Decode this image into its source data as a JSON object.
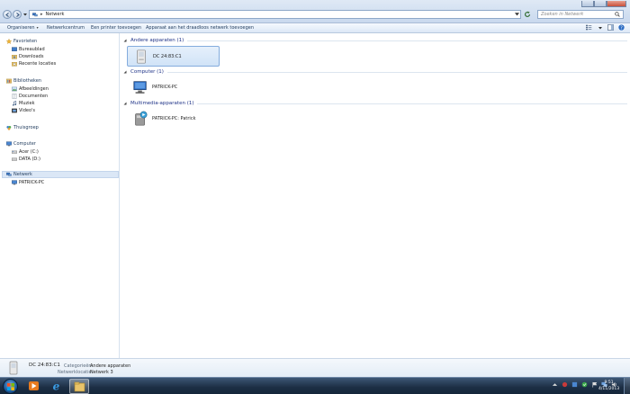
{
  "address_bar": {
    "breadcrumb": "Netwerk",
    "separator": "▸",
    "search_placeholder": "Zoeken in Netwerk"
  },
  "command_bar": {
    "organize": "Organiseren",
    "network_center": "Netwerkcentrum",
    "add_printer": "Een printer toevoegen",
    "add_wireless": "Apparaat aan het draadloos netwerk toevoegen"
  },
  "navigation": {
    "favorites": {
      "label": "Favorieten",
      "items": [
        "Bureaublad",
        "Downloads",
        "Recente locaties"
      ]
    },
    "libraries": {
      "label": "Bibliotheken",
      "items": [
        "Afbeeldingen",
        "Documenten",
        "Muziek",
        "Video's"
      ]
    },
    "homegroup": {
      "label": "Thuisgroep"
    },
    "computer": {
      "label": "Computer",
      "items": [
        "Acer (C:)",
        "DATA (D:)"
      ]
    },
    "network": {
      "label": "Netwerk",
      "items": [
        "PATRICK-PC"
      ]
    }
  },
  "groups": [
    {
      "title": "Andere apparaten (1)",
      "items": [
        {
          "name": "DC 24:83:C1",
          "selected": true
        }
      ]
    },
    {
      "title": "Computer (1)",
      "items": [
        {
          "name": "PATRICK-PC",
          "selected": false
        }
      ]
    },
    {
      "title": "Multimedia-apparaten (1)",
      "items": [
        {
          "name": "PATRICK-PC: Patrick",
          "selected": false
        }
      ]
    }
  ],
  "details": {
    "name": "DC 24:83:C1",
    "category_label": "Categorieën:",
    "category_value": "Andere apparaten",
    "location_label": "Netwerklocatie:",
    "location_value": "Netwerk 3"
  },
  "taskbar": {
    "time": "9:51",
    "date": "4/11/2013"
  },
  "colors": {
    "accent": "#1e3287",
    "selection": "#d1e3f7",
    "taskbar": "#1c2e44"
  }
}
